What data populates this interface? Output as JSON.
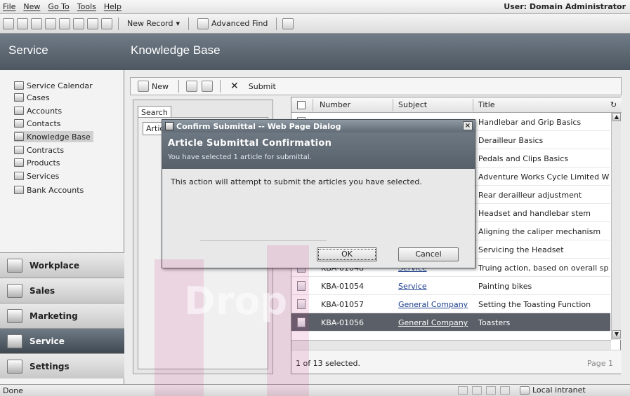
{
  "menu": {
    "items": [
      "File",
      "New",
      "Go To",
      "Tools",
      "Help"
    ],
    "user": "User: Domain Administrator"
  },
  "toolbar": {
    "new_record": "New Record",
    "advanced_find": "Advanced Find"
  },
  "header": {
    "area": "Service",
    "page": "Knowledge Base"
  },
  "nav": {
    "items": [
      "Service Calendar",
      "Cases",
      "Accounts",
      "Contacts",
      "Knowledge Base",
      "Contracts",
      "Products",
      "Services",
      "Bank Accounts"
    ],
    "selected": "Knowledge Base",
    "wunderbar": [
      "Workplace",
      "Sales",
      "Marketing",
      "Service",
      "Settings"
    ],
    "active_wunderbar": "Service"
  },
  "content_toolbar": {
    "new": "New",
    "submit": "Submit"
  },
  "search_pane": {
    "tab": "Search",
    "inner_tab": "Artic"
  },
  "grid": {
    "headers": [
      "Number",
      "Subject",
      "Title"
    ],
    "rows": [
      {
        "number": "KBA-01048",
        "subject": "Service",
        "title": "Truing action, based on overall sp"
      },
      {
        "number": "KBA-01054",
        "subject": "Service",
        "title": "Painting bikes"
      },
      {
        "number": "KBA-01057",
        "subject": "General Company",
        "title": "Setting the Toasting Function"
      },
      {
        "number": "KBA-01056",
        "subject": "General Company",
        "title": "Toasters"
      }
    ],
    "titles_visible": [
      "Handlebar and Grip Basics",
      "Derailleur Basics",
      "Pedals and Clips Basics",
      "Adventure Works Cycle Limited W",
      "Rear derailleur adjustment",
      "Headset and handlebar stem",
      "Aligning the caliper mechanism",
      "Servicing the Headset"
    ],
    "selection_count": "1 of 13 selected.",
    "page": "Page 1"
  },
  "dialog": {
    "title": "Confirm Submittal -- Web Page Dialog",
    "heading": "Article Submittal Confirmation",
    "subheading": "You have selected 1 article for submittal.",
    "message": "This action will attempt to submit the articles you have selected.",
    "ok_label": "OK",
    "cancel_label": "Cancel",
    "close_glyph": "×"
  },
  "status": {
    "left": "Done",
    "zone": "Local intranet"
  },
  "watermark": {
    "text": "Drop"
  },
  "colors": {
    "header_bg": "#5b6670",
    "selected_row": "#5b6068",
    "link": "#1c3f8f"
  }
}
